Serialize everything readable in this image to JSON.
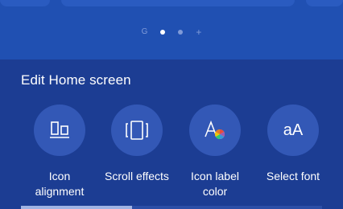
{
  "home_preview": {
    "page_indicators": [
      {
        "icon": "g-page-icon",
        "label": "G"
      },
      {
        "icon": "dot-active"
      },
      {
        "icon": "dot-inactive"
      },
      {
        "icon": "add-page-icon",
        "label": "+"
      }
    ]
  },
  "edit_panel": {
    "title": "Edit Home screen",
    "options": [
      {
        "label": "Icon alignment",
        "icon": "icon-alignment-icon"
      },
      {
        "label": "Scroll effects",
        "icon": "scroll-effects-icon"
      },
      {
        "label": "Icon label color",
        "icon": "icon-label-color-icon"
      },
      {
        "label": "Select font",
        "icon": "select-font-icon",
        "glyph": "aA"
      }
    ]
  },
  "colors": {
    "background": "#1c3d93",
    "preview_background": "#2050b2",
    "icon_circle": "#3358b6",
    "text": "#ffffff"
  },
  "scroll": {
    "position_fraction": 0.0
  }
}
